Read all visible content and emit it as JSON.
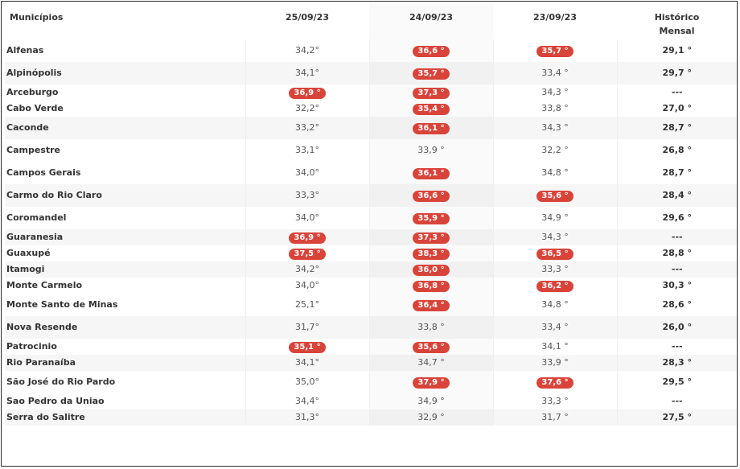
{
  "headers": {
    "municipio": "Municípios",
    "d1": "25/09/23",
    "d2": "24/09/23",
    "d3": "23/09/23",
    "hist_line1": "Histórico",
    "hist_line2": "Mensal"
  },
  "colors": {
    "highlight": "#d9443a",
    "text": "#333333",
    "muted": "#555555"
  },
  "rows": [
    {
      "name": "Alfenas",
      "d1": "34,2°",
      "d2": "36,6 °",
      "d3": "35,7 °",
      "hist": "29,1 °",
      "hl": [
        false,
        true,
        true
      ]
    },
    {
      "name": "Alpinópolis",
      "d1": "34,1°",
      "d2": "35,7 °",
      "d3": "33,4 °",
      "hist": "29,7 °",
      "hl": [
        false,
        true,
        false
      ]
    },
    {
      "name": "Arceburgo",
      "d1": "36,9 °",
      "d2": "37,3 °",
      "d3": "34,3 °",
      "hist": "---",
      "hl": [
        true,
        true,
        false
      ]
    },
    {
      "name": "Cabo Verde",
      "d1": "32,2°",
      "d2": "35,4 °",
      "d3": "33,8 °",
      "hist": "27,0 °",
      "hl": [
        false,
        true,
        false
      ]
    },
    {
      "name": "Caconde",
      "d1": "33,2°",
      "d2": "36,1 °",
      "d3": "34,3 °",
      "hist": "28,7 °",
      "hl": [
        false,
        true,
        false
      ]
    },
    {
      "name": "Campestre",
      "d1": "33,1°",
      "d2": "33,9 °",
      "d3": "32,2 °",
      "hist": "26,8 °",
      "hl": [
        false,
        false,
        false
      ]
    },
    {
      "name": "Campos Gerais",
      "d1": "34,0°",
      "d2": "36,1 °",
      "d3": "34,8 °",
      "hist": "28,7 °",
      "hl": [
        false,
        true,
        false
      ]
    },
    {
      "name": "Carmo do Rio Claro",
      "d1": "33,3°",
      "d2": "36,6 °",
      "d3": "35,6 °",
      "hist": "28,4 °",
      "hl": [
        false,
        true,
        true
      ]
    },
    {
      "name": "Coromandel",
      "d1": "34,0°",
      "d2": "35,9 °",
      "d3": "34,9 °",
      "hist": "29,6 °",
      "hl": [
        false,
        true,
        false
      ]
    },
    {
      "name": "Guaranesia",
      "d1": "36,9 °",
      "d2": "37,3 °",
      "d3": "34,3 °",
      "hist": "---",
      "hl": [
        true,
        true,
        false
      ]
    },
    {
      "name": "Guaxupé",
      "d1": "37,5 °",
      "d2": "38,3 °",
      "d3": "36,5 °",
      "hist": "28,8 °",
      "hl": [
        true,
        true,
        true
      ]
    },
    {
      "name": "Itamogi",
      "d1": "34,2°",
      "d2": "36,0 °",
      "d3": "33,3 °",
      "hist": "---",
      "hl": [
        false,
        true,
        false
      ]
    },
    {
      "name": "Monte Carmelo",
      "d1": "34,0°",
      "d2": "36,8 °",
      "d3": "36,2 °",
      "hist": "30,3 °",
      "hl": [
        false,
        true,
        true
      ]
    },
    {
      "name": "Monte Santo de Minas",
      "d1": "25,1°",
      "d2": "36,4 °",
      "d3": "34,8 °",
      "hist": "28,6 °",
      "hl": [
        false,
        true,
        false
      ]
    },
    {
      "name": "Nova Resende",
      "d1": "31,7°",
      "d2": "33,8 °",
      "d3": "33,4 °",
      "hist": "26,0 °",
      "hl": [
        false,
        false,
        false
      ]
    },
    {
      "name": "Patrocinio",
      "d1": "35,1 °",
      "d2": "35,6 °",
      "d3": "34,1 °",
      "hist": "---",
      "hl": [
        true,
        true,
        false
      ]
    },
    {
      "name": "Rio Paranaíba",
      "d1": "34,1°",
      "d2": "34,7 °",
      "d3": "33,9 °",
      "hist": "28,3 °",
      "hl": [
        false,
        false,
        false
      ]
    },
    {
      "name": "São José do Rio Pardo",
      "d1": "35,0°",
      "d2": "37,9 °",
      "d3": "37,6 °",
      "hist": "29,5 °",
      "hl": [
        false,
        true,
        true
      ]
    },
    {
      "name": "Sao Pedro da Uniao",
      "d1": "34,4°",
      "d2": "34,9 °",
      "d3": "33,3 °",
      "hist": "---",
      "hl": [
        false,
        false,
        false
      ]
    },
    {
      "name": "Serra do Salitre",
      "d1": "31,3°",
      "d2": "32,9 °",
      "d3": "31,7 °",
      "hist": "27,5 °",
      "hl": [
        false,
        false,
        false
      ]
    }
  ]
}
